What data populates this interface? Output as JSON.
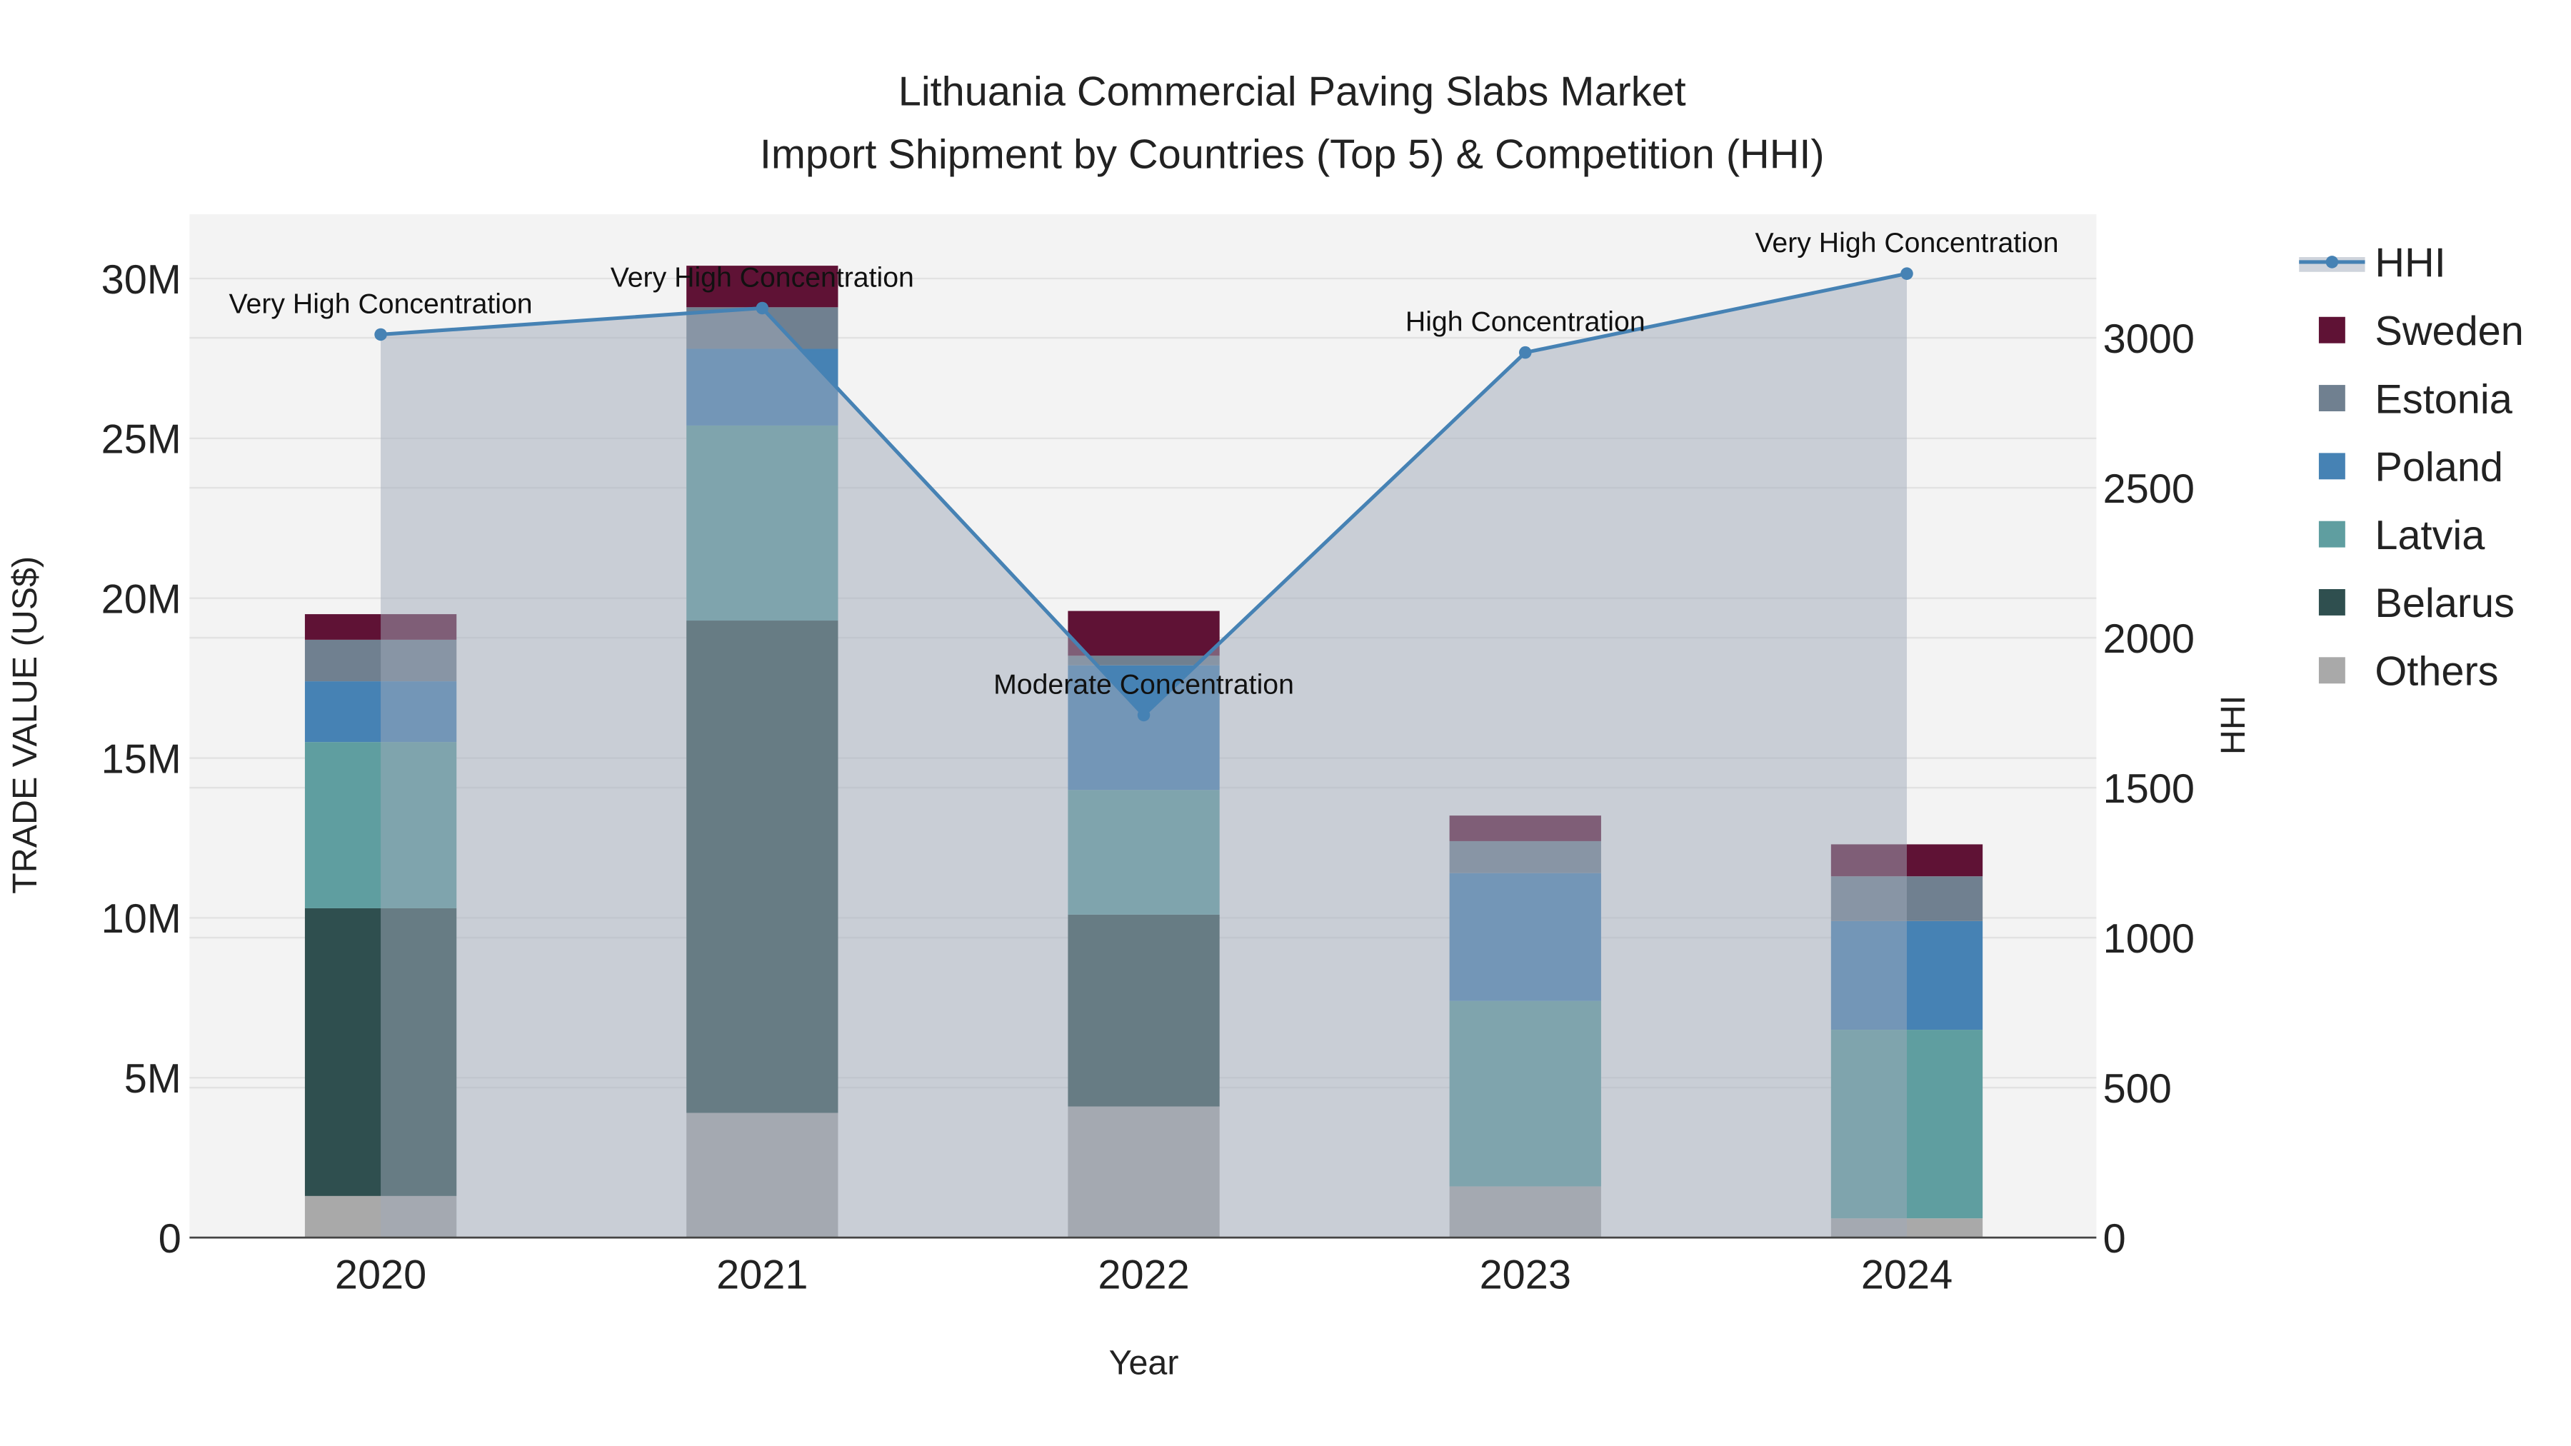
{
  "chart_data": {
    "type": "bar",
    "title": "Lithuania Commercial Paving Slabs Market",
    "subtitle": "Import Shipment by Countries (Top 5) & Competition (HHI)",
    "xlabel": "Year",
    "ylabel": "TRADE VALUE (US$)",
    "y2label": "HHI",
    "categories": [
      "2020",
      "2021",
      "2022",
      "2023",
      "2024"
    ],
    "ylim": [
      0,
      32000000
    ],
    "yticks": [
      {
        "v": 0,
        "label": "0"
      },
      {
        "v": 5000000,
        "label": "5M"
      },
      {
        "v": 10000000,
        "label": "10M"
      },
      {
        "v": 15000000,
        "label": "15M"
      },
      {
        "v": 20000000,
        "label": "20M"
      },
      {
        "v": 25000000,
        "label": "25M"
      },
      {
        "v": 30000000,
        "label": "30M"
      }
    ],
    "y2lim": [
      0,
      3410
    ],
    "y2ticks": [
      0,
      500,
      1000,
      1500,
      2000,
      2500,
      3000
    ],
    "stacked": true,
    "series": [
      {
        "name": "Others",
        "color": "#a9a9a9",
        "values": [
          1300000,
          3900000,
          4100000,
          1600000,
          600000
        ]
      },
      {
        "name": "Belarus",
        "color": "#2f4f4f",
        "values": [
          9000000,
          15400000,
          6000000,
          0,
          0
        ]
      },
      {
        "name": "Latvia",
        "color": "#5f9ea0",
        "values": [
          5200000,
          6100000,
          3900000,
          5800000,
          5900000
        ]
      },
      {
        "name": "Poland",
        "color": "#4682b4",
        "values": [
          1900000,
          2400000,
          3900000,
          4000000,
          3400000
        ]
      },
      {
        "name": "Estonia",
        "color": "#708090",
        "values": [
          1300000,
          1300000,
          300000,
          1000000,
          1400000
        ]
      },
      {
        "name": "Sweden",
        "color": "#5f1235",
        "values": [
          800000,
          1300000,
          1400000,
          800000,
          1000000
        ]
      }
    ],
    "hhi": {
      "name": "HHI",
      "color": "#4682b4",
      "values": [
        3011,
        3099,
        1742,
        2951,
        3214
      ],
      "annotations": [
        "Very High Concentration",
        "Very High Concentration",
        "Moderate Concentration",
        "High Concentration",
        "Very High Concentration"
      ]
    },
    "legend_order": [
      "HHI",
      "Sweden",
      "Estonia",
      "Poland",
      "Latvia",
      "Belarus",
      "Others"
    ],
    "legend_position": "right",
    "grid": true
  }
}
